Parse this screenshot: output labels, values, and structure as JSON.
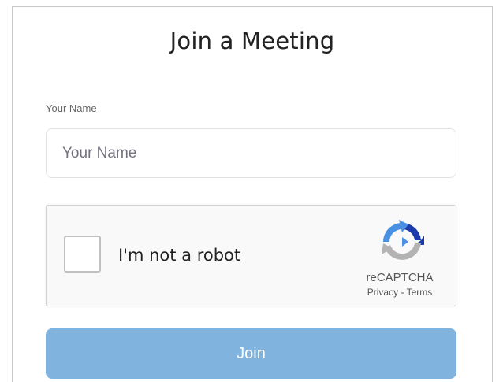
{
  "page": {
    "title": "Join a Meeting"
  },
  "form": {
    "name_label": "Your Name",
    "name_value": "",
    "name_placeholder": "Your Name"
  },
  "captcha": {
    "checkbox_label": "I'm not a robot",
    "brand": "reCAPTCHA",
    "privacy_link": "Privacy",
    "separator": " - ",
    "terms_link": "Terms",
    "icon": "recaptcha-logo-icon"
  },
  "join_button": {
    "label": "Join"
  },
  "colors": {
    "button_bg": "#80b3dd",
    "recaptcha_blue": "#4a90e2",
    "recaptcha_dark_blue": "#1c3aa9",
    "recaptcha_gray": "#b3b3b3"
  }
}
